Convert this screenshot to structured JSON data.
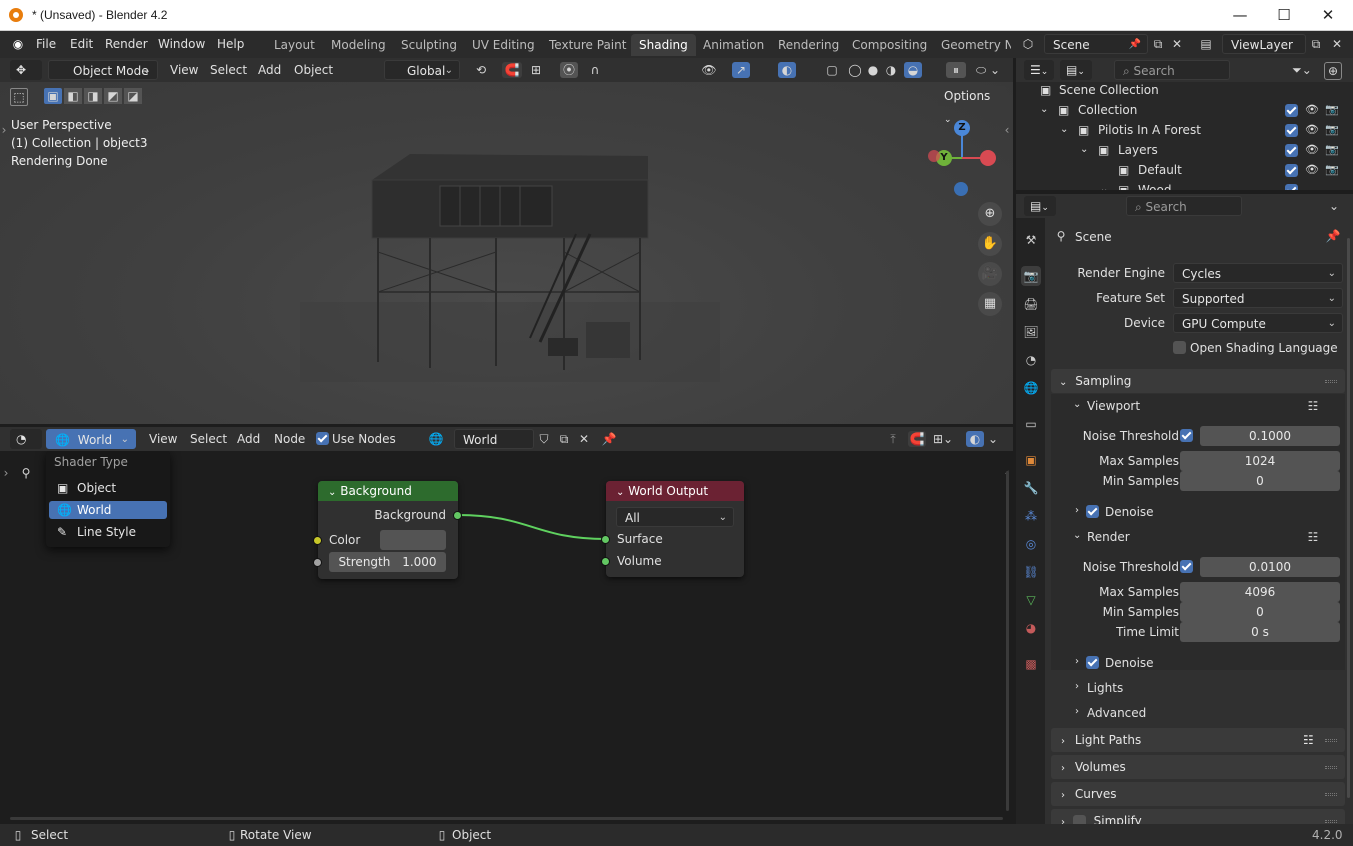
{
  "window": {
    "title": "* (Unsaved) - Blender 4.2"
  },
  "menu": {
    "file": "File",
    "edit": "Edit",
    "render": "Render",
    "window": "Window",
    "help": "Help"
  },
  "workspaces": [
    "Layout",
    "Modeling",
    "Sculpting",
    "UV Editing",
    "Texture Paint",
    "Shading",
    "Animation",
    "Rendering",
    "Compositing",
    "Geometry Nc"
  ],
  "scene_selector": {
    "scene": "Scene",
    "view_layer": "ViewLayer"
  },
  "viewport": {
    "mode": "Object Mode",
    "menus": [
      "View",
      "Select",
      "Add",
      "Object"
    ],
    "transform": "Global",
    "options": "Options",
    "overlay_text": [
      "User Perspective",
      "(1) Collection | object3",
      "Rendering Done"
    ],
    "axes": {
      "z": "Z",
      "y": "Y"
    }
  },
  "node_editor": {
    "shader_type": "World",
    "menus": [
      "View",
      "Select",
      "Add",
      "Node"
    ],
    "use_nodes": "Use Nodes",
    "world_name": "World",
    "popup": {
      "title": "Shader Type",
      "items": [
        "Object",
        "World",
        "Line Style"
      ],
      "selected": "World"
    },
    "nodes": {
      "background": {
        "title": "Background",
        "output": "Background",
        "color": "Color",
        "strength_label": "Strength",
        "strength_value": "1.000",
        "header_color": "#2d6b2d"
      },
      "world_output": {
        "title": "World Output",
        "target": "All",
        "surface": "Surface",
        "volume": "Volume",
        "header_color": "#6b2233"
      }
    }
  },
  "outliner": {
    "search_placeholder": "Search",
    "items": [
      "Scene Collection",
      "Collection",
      "Pilotis In A Forest",
      "Layers",
      "Default",
      "Wood"
    ]
  },
  "properties": {
    "search_placeholder": "Search",
    "context": "Scene",
    "render_engine": {
      "label": "Render Engine",
      "value": "Cycles"
    },
    "feature_set": {
      "label": "Feature Set",
      "value": "Supported"
    },
    "device": {
      "label": "Device",
      "value": "GPU Compute"
    },
    "osl": "Open Shading Language",
    "sampling": "Sampling",
    "viewport": {
      "title": "Viewport",
      "noise_label": "Noise Threshold",
      "noise_value": "0.1000",
      "max_label": "Max Samples",
      "max_value": "1024",
      "min_label": "Min Samples",
      "min_value": "0",
      "denoise": "Denoise"
    },
    "render": {
      "title": "Render",
      "noise_label": "Noise Threshold",
      "noise_value": "0.0100",
      "max_label": "Max Samples",
      "max_value": "4096",
      "min_label": "Min Samples",
      "min_value": "0",
      "time_label": "Time Limit",
      "time_value": "0 s",
      "denoise": "Denoise"
    },
    "lights": "Lights",
    "advanced": "Advanced",
    "light_paths": "Light Paths",
    "volumes": "Volumes",
    "curves": "Curves",
    "simplify": "Simplify"
  },
  "statusbar": {
    "select": "Select",
    "rotate": "Rotate View",
    "object": "Object",
    "version": "4.2.0"
  }
}
